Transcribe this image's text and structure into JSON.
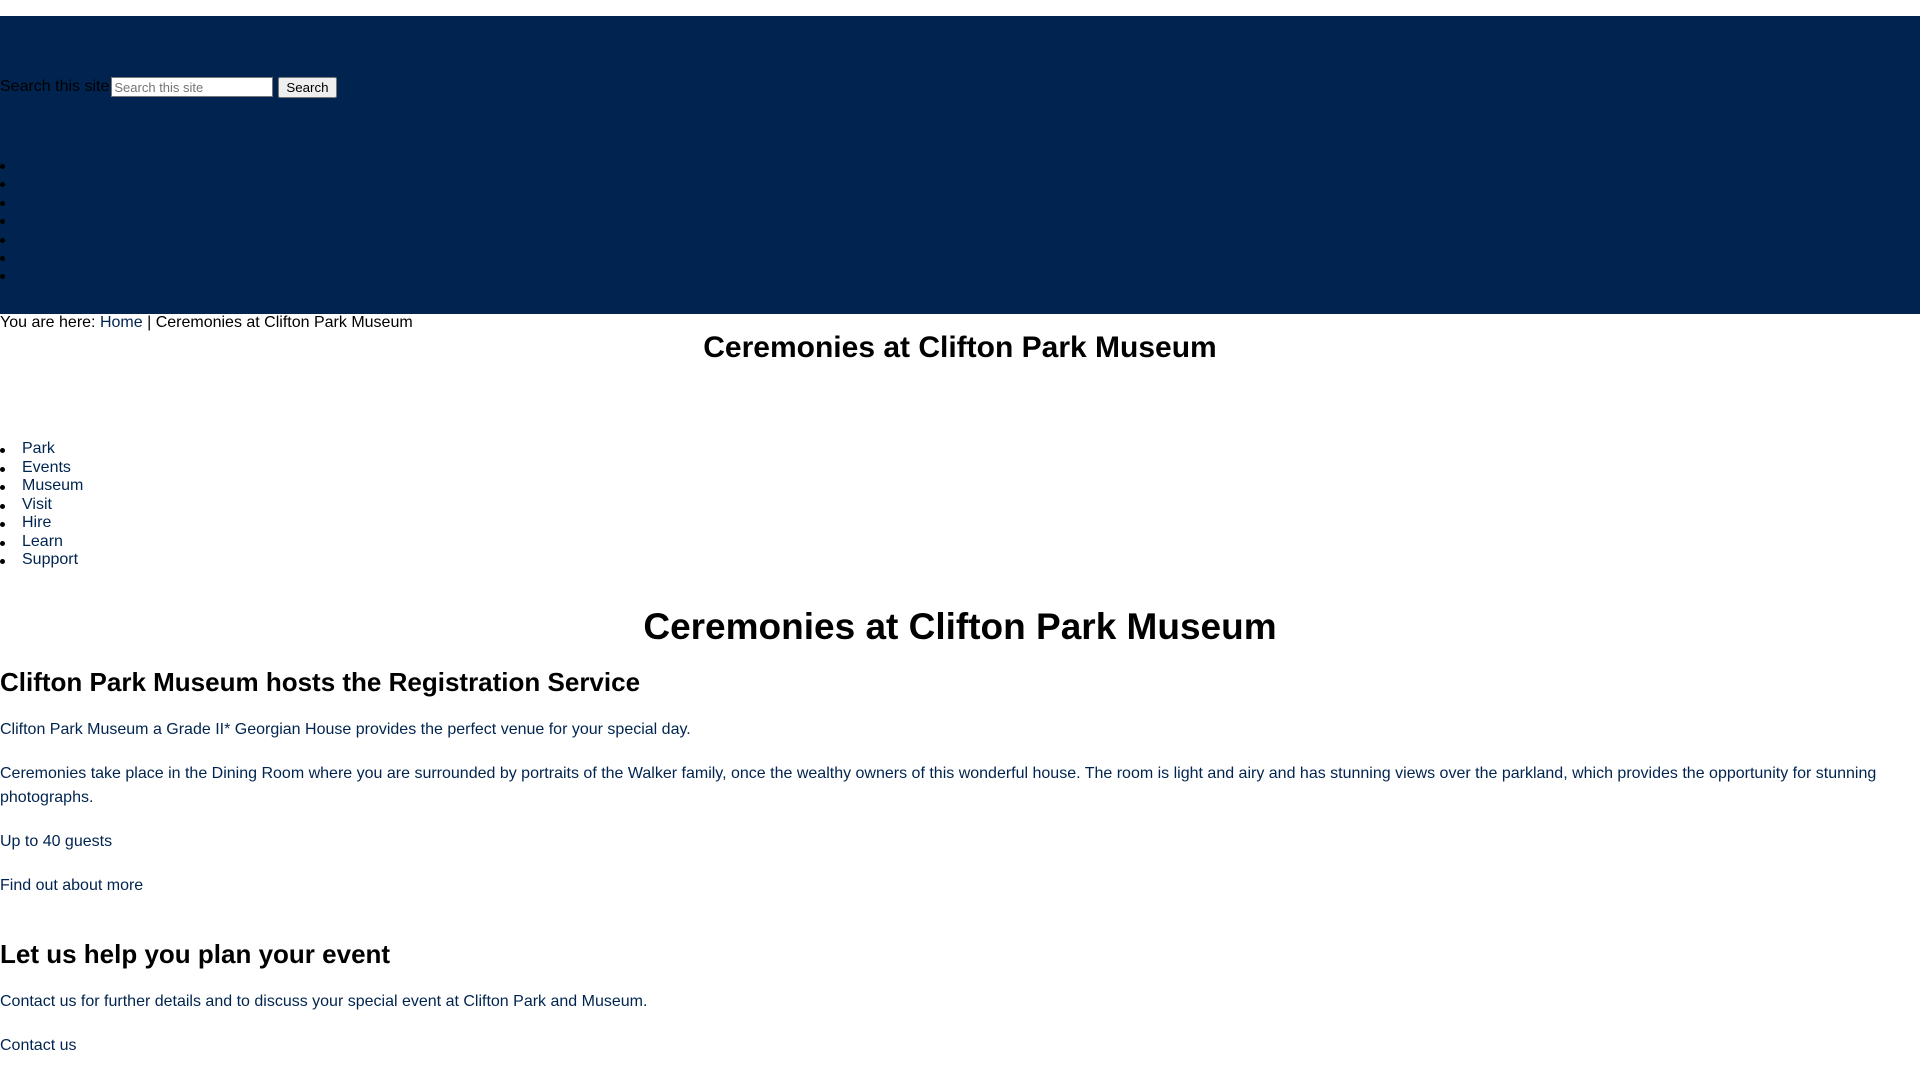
{
  "search": {
    "label": "Search this site",
    "placeholder": "Search this site",
    "button_label": "Search"
  },
  "header": {
    "background": "#00244f",
    "empty_menu_count": 7
  },
  "breadcrumb": {
    "prefix": "You are here:",
    "home": "Home",
    "separator": "|",
    "current": "Ceremonies at Clifton Park Museum"
  },
  "page_title": "Ceremonies at Clifton Park Museum",
  "nav": {
    "items": [
      {
        "label": "Park"
      },
      {
        "label": "Events"
      },
      {
        "label": "Museum"
      },
      {
        "label": "Visit"
      },
      {
        "label": "Hire"
      },
      {
        "label": "Learn"
      },
      {
        "label": "Support"
      }
    ]
  },
  "main": {
    "heading": "Ceremonies at Clifton Park Museum",
    "section1": {
      "heading": "Clifton Park Museum hosts the Registration Service",
      "p1": "Clifton Park Museum a Grade II* Georgian House provides the perfect venue for your special day.",
      "p2": "Ceremonies take place in the Dining Room where you are surrounded by portraits of the Walker family, once the wealthy owners of this wonderful house. The room is light and airy and has stunning views over the parkland, which provides the opportunity for stunning photographs.",
      "p3": "Up to 40 guests",
      "link": "Find out about more"
    },
    "section2": {
      "heading": "Let us help you plan your event",
      "p1": "Contact us for further details and to discuss your special event at Clifton Park and Museum.",
      "link": "Contact us"
    }
  },
  "colors": {
    "brand_navy": "#00244f",
    "text": "#000000"
  }
}
